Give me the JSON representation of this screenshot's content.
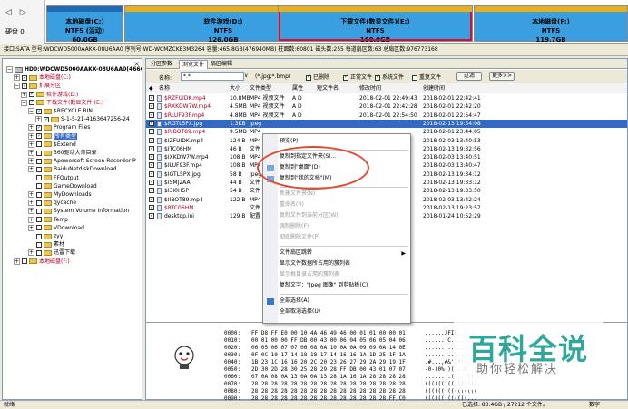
{
  "disk_bar": {
    "label": "硬盘 0",
    "nav_prev": "◁",
    "nav_next": "▷",
    "partitions": [
      {
        "name": "本地磁盘(C:)",
        "fs": "NTFS (活动)",
        "size": "60.0GB",
        "color": "#3a9fe0",
        "stripe": "#1f6bb5",
        "selected": false
      },
      {
        "name": "软件游戏(D:)",
        "fs": "NTFS",
        "size": "126.0GB",
        "color": "#3a9fe0",
        "stripe": "#e8b020",
        "selected": false
      },
      {
        "name": "下载文件(数显文件)(E:)",
        "fs": "NTFS",
        "size": "160.0GB",
        "color": "#3a9fe0",
        "stripe": "#e8b020",
        "selected": true
      },
      {
        "name": "本地磁盘(F:)",
        "fs": "NTFS",
        "size": "119.7GB",
        "color": "#3a9fe0",
        "stripe": "#e8b020",
        "selected": false
      }
    ]
  },
  "info_line": "接口:SATA  型号:WDCWD5000AAKX-08U6AA0  序列号:WD-WCMZCKE3M3264  容量:465.8GB(476940MB)  柱面数:60801  磁头数:255  每道扇区数:63  总扇区数:976773168",
  "tree": {
    "close": "×",
    "items": [
      {
        "exp": "−",
        "text": "HD0:WDCWD5000AAKX-08U6AA0(466GB)",
        "icon": "hdd",
        "cb": false,
        "indent": 0,
        "style": "bold"
      },
      {
        "exp": "+",
        "text": "本地磁盘(C:)",
        "icon": "folder",
        "cb": true,
        "indent": 1,
        "style": "red"
      },
      {
        "exp": "−",
        "text": "扩展分区",
        "icon": "folder",
        "cb": true,
        "indent": 1,
        "style": "red"
      },
      {
        "exp": "+",
        "text": "软件游戏(D:)",
        "icon": "folder",
        "cb": true,
        "indent": 2,
        "style": "red"
      },
      {
        "exp": "−",
        "text": "下载文件(数显文件)(E:)",
        "icon": "folder",
        "cb": true,
        "indent": 2,
        "style": "red"
      },
      {
        "exp": "−",
        "text": "$RECYCLE.BIN",
        "icon": "folder",
        "cb": true,
        "indent": 3,
        "style": "normal"
      },
      {
        "exp": "+",
        "text": "S-1-5-21-4163647256-24",
        "icon": "folder",
        "cb": true,
        "indent": 4,
        "style": "normal"
      },
      {
        "exp": "+",
        "text": "Program Files",
        "icon": "folder",
        "cb": true,
        "indent": 3,
        "style": "normal"
      },
      {
        "exp": "+",
        "text": "所有类型",
        "icon": "folder",
        "cb": true,
        "indent": 3,
        "style": "hl"
      },
      {
        "exp": "+",
        "text": "$Extend",
        "icon": "folder",
        "cb": false,
        "indent": 3,
        "style": "normal"
      },
      {
        "exp": "+",
        "text": "360驱动大师目录",
        "icon": "folder",
        "cb": false,
        "indent": 3,
        "style": "normal"
      },
      {
        "exp": "+",
        "text": "Apowersoft Screen Recorder P",
        "icon": "folder",
        "cb": false,
        "indent": 3,
        "style": "normal"
      },
      {
        "exp": "+",
        "text": "BaiduNetdiskDownload",
        "icon": "folder",
        "cb": false,
        "indent": 3,
        "style": "normal"
      },
      {
        "exp": "",
        "text": "FFOutput",
        "icon": "folder",
        "cb": false,
        "indent": 3,
        "style": "normal"
      },
      {
        "exp": "",
        "text": "GameDownload",
        "icon": "folder",
        "cb": false,
        "indent": 3,
        "style": "normal"
      },
      {
        "exp": "+",
        "text": "MyDownloads",
        "icon": "folder",
        "cb": false,
        "indent": 3,
        "style": "normal"
      },
      {
        "exp": "+",
        "text": "qycache",
        "icon": "folder",
        "cb": false,
        "indent": 3,
        "style": "normal"
      },
      {
        "exp": "+",
        "text": "System Volume Information",
        "icon": "folder",
        "cb": false,
        "indent": 3,
        "style": "normal"
      },
      {
        "exp": "+",
        "text": "Temp",
        "icon": "folder",
        "cb": false,
        "indent": 3,
        "style": "normal"
      },
      {
        "exp": "+",
        "text": "VDownload",
        "icon": "folder",
        "cb": false,
        "indent": 3,
        "style": "normal"
      },
      {
        "exp": "",
        "text": "zyy",
        "icon": "folder",
        "cb": false,
        "indent": 3,
        "style": "normal"
      },
      {
        "exp": "",
        "text": "素材",
        "icon": "folder",
        "cb": false,
        "indent": 3,
        "style": "normal"
      },
      {
        "exp": "+",
        "text": "迅雷下载",
        "icon": "folder",
        "cb": false,
        "indent": 3,
        "style": "normal"
      },
      {
        "exp": "+",
        "text": "本地磁盘(F:)",
        "icon": "folder",
        "cb": false,
        "indent": 1,
        "style": "red"
      }
    ]
  },
  "tabs": [
    "分区参数",
    "浏览文件",
    "扇区编辑"
  ],
  "filter": {
    "label": "名称:",
    "value": "*.*",
    "dropdown": "∨",
    "hint": "(*.jpg;*.bmp)",
    "checks": [
      {
        "label": "已删除",
        "checked": true
      },
      {
        "label": "正常文件",
        "checked": true
      },
      {
        "label": "系统文件",
        "checked": true
      },
      {
        "label": "重复文件",
        "checked": false
      }
    ],
    "filter_button": "过滤",
    "more_button": "更多>>"
  },
  "columns": [
    "名称",
    "大小",
    "文件类型",
    "属性",
    "短文件名",
    "修改时间",
    "创建时间"
  ],
  "files": [
    {
      "name": "$RZFUIDK.mp4",
      "size": "10.8MB",
      "type": "MP4 视频文件",
      "attr": "A D",
      "modified": "2018-02-01 22:49:43",
      "created": "2018-02-01 22:42:41"
    },
    {
      "name": "$RXKDW7W.mp4",
      "size": "4.5MB",
      "type": "MP4 视频文件",
      "attr": "A D",
      "modified": "2018-02-01 22:42:28",
      "created": "2018-02-01 22:42:20"
    },
    {
      "name": "$RLUF93F.mp4",
      "size": "4.8MB",
      "type": "MP4 视频文件",
      "attr": "A D",
      "modified": "2018-02-01 22:54:50",
      "created": "2018-02-01 22:54:47"
    },
    {
      "name": "$RGTL5PX.jpg",
      "size": "1.3KB",
      "type": "Jpeg",
      "attr": "",
      "modified": "",
      "created": "2018-02-13 19:34:08"
    },
    {
      "name": "$RIBOT89.mp4",
      "size": "9.5MB",
      "type": "MP4",
      "attr": "",
      "modified": "",
      "created": "2018-02-01 23:44:05"
    },
    {
      "name": "$IZFUIDK.mp4",
      "size": "124 B",
      "type": "MP4",
      "attr": "",
      "modified": "",
      "created": "2018-02-03 13:40:53"
    },
    {
      "name": "$ITC06HM",
      "size": "46 B",
      "type": "文件",
      "attr": "",
      "modified": "",
      "created": "2018-02-13 19:32:56"
    },
    {
      "name": "$IXKDW7W.mp4",
      "size": "108 B",
      "type": "MP4",
      "attr": "",
      "modified": "",
      "created": "2018-02-03 13:40:51"
    },
    {
      "name": "$ILUF93F.mp4",
      "size": "108 B",
      "type": "MP4",
      "attr": "",
      "modified": "",
      "created": "2018-02-03 13:40:47"
    },
    {
      "name": "$IGTL5PX.jpg",
      "size": "58 B",
      "type": "Jpeg",
      "attr": "",
      "modified": "",
      "created": "2018-02-13 19:34:12"
    },
    {
      "name": "$I5MJ2AA",
      "size": "44 B",
      "type": "文件",
      "attr": "",
      "modified": "",
      "created": "2018-02-13 19:33:12"
    },
    {
      "name": "$I3I0H5P",
      "size": "54 B",
      "type": "文件",
      "attr": "",
      "modified": "",
      "created": "2018-02-13 19:33:50"
    },
    {
      "name": "$IIBOT89.mp4",
      "size": "122 B",
      "type": "MP4",
      "attr": "",
      "modified": "",
      "created": "2018-02-03 13:42:24"
    },
    {
      "name": "$RTC06HM",
      "size": "",
      "type": "文件",
      "attr": "",
      "modified": "",
      "created": "2018-02-13 19:23:57"
    },
    {
      "name": "desktop.ini",
      "size": "129 B",
      "type": "配置",
      "attr": "",
      "modified": "",
      "created": "2018-01-24 10:52:29"
    }
  ],
  "context_menu": [
    {
      "label": "预览(P)",
      "disabled": false,
      "sep_before": false,
      "arrow": false
    },
    {
      "label": "复制到指定文件夹(S)...",
      "disabled": false,
      "sep_before": true,
      "arrow": false
    },
    {
      "label": "复制到\"桌面\"(D)",
      "disabled": false,
      "sep_before": false,
      "arrow": false
    },
    {
      "label": "复制到\"我的文档\"(M)",
      "disabled": false,
      "sep_before": false,
      "arrow": false
    },
    {
      "label": "新建文件夹(N)",
      "disabled": true,
      "sep_before": true,
      "arrow": false
    },
    {
      "label": "重命名(R)",
      "disabled": true,
      "sep_before": false,
      "arrow": false
    },
    {
      "label": "复制文件到当前分区(W)",
      "disabled": true,
      "sep_before": false,
      "arrow": false
    },
    {
      "label": "强制删除(F)",
      "disabled": true,
      "sep_before": false,
      "arrow": false
    },
    {
      "label": "彻底删除文件(P)",
      "disabled": true,
      "sep_before": false,
      "arrow": false
    },
    {
      "label": "文件扇区跳转",
      "disabled": false,
      "sep_before": true,
      "arrow": true
    },
    {
      "label": "显示文件数据所占用的簇列表",
      "disabled": false,
      "sep_before": false,
      "arrow": false
    },
    {
      "label": "显示根目录占用的簇列表",
      "disabled": true,
      "sep_before": false,
      "arrow": false
    },
    {
      "label": "复制文字：\"Jpeg 图像\" 到剪贴板(C)",
      "disabled": false,
      "sep_before": false,
      "arrow": false
    },
    {
      "label": "全部选择(A)",
      "disabled": false,
      "sep_before": true,
      "arrow": false
    },
    {
      "label": "全部取消选择(U)",
      "disabled": false,
      "sep_before": false,
      "arrow": false
    }
  ],
  "hex": {
    "addresses": [
      "0000:",
      "0010:",
      "0020:",
      "0030:",
      "0040:",
      "0050:",
      "0060:",
      "0070:",
      "0080:",
      "0090:"
    ],
    "bytes": [
      "FF D8 FF E0 00 10 4A 46 49 46 00 01 01 00 00 01",
      "00 01 00 00 FF DB 00 43 00 06 04 05 06 05 04 06",
      "06 05 06 07 07 06 08 0A 10 0A 0A 09 09 0A 14 0E",
      "0F 0C 10 17 14 18 18 17 14 16 16 1A 1D 25 1F 1A",
      "1B 23 1C 16 16 20 2C 20 23 26 27 29 2A 29 19 1F",
      "2D 30 2D 28 30 25 28 29 28 FF DB 00 43 01 07 07",
      "07 0A 08 0A 13 0A 0A 13 28 1A 16 1A 28 28 28 28",
      "28 28 28 28 28 28 28 28 28 28 28 28 28 28 28 28",
      "28 28 28 28 28 28 28 28 28 28 28 28 28 28 28 28",
      "28 28 28 28 28 28 28 28 28 28 28 28 28 28 FF C0"
    ],
    "ascii": [
      "......JFIF......",
      ".......C........",
      "................",
      ".........%......",
      ".#...,#&')*)..",
      "-0-(0%()(...C...",
      "........(....((",
      "((((((((((((((((",
      "((((((((((((((((",
      "(((((((((((((..."
    ]
  },
  "watermark": {
    "main": "百科全说",
    "sub": "助你轻松解决"
  },
  "status": {
    "left": "就绪",
    "mid": "已选择: 83.4GB / 27212 个文件。",
    "num": "数字"
  }
}
